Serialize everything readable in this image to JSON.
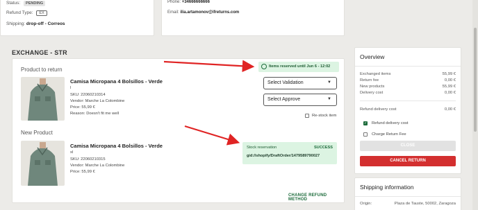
{
  "top_left": {
    "status_label": "Status:",
    "status_value": "PENDING",
    "refund_type_label": "Refund Type:",
    "refund_type_value": "EX",
    "shipping_label": "Shipping:",
    "shipping_value": "drop-off - Correos"
  },
  "top_right": {
    "phone_label": "Phone:",
    "phone_value": "+34666666666",
    "email_label": "Email:",
    "email_value": "ilia.artamonov@ifreturns.com"
  },
  "exchange": {
    "title": "EXCHANGE - STR",
    "product_to_return_label": "Product to return",
    "reserved_badge": "Items reserved until Jun 6 - 12:02",
    "return_item": {
      "name": "Camisa Micropana 4 Bolsillos - Verde",
      "size": "l",
      "sku": "SKU: 22060210314",
      "vendor_label": "Vendor:",
      "vendor": "Marche La Colombine",
      "price": "Price: 55,99 €",
      "reason_label": "Reason:",
      "reason": "Doesn't fit me well"
    },
    "select_validation": "Select Validation",
    "select_approve": "Select Approve",
    "restock_label": "Re-stock item",
    "new_product_label": "New Product",
    "new_item": {
      "name": "Camisa Micropana 4 Bolsillos - Verde",
      "size": "xl",
      "sku": "SKU: 22060210315",
      "vendor_label": "Vendor:",
      "vendor": "Marche La Colombine",
      "price": "Price: 55,99 €"
    },
    "stock": {
      "label": "Stock reservation",
      "status": "SUCCESS",
      "gid": "gid://shopify/DraftOrder/1479589790027"
    },
    "change_refund_method": "CHANGE REFUND METHOD"
  },
  "overview": {
    "title": "Overview",
    "rows": [
      {
        "label": "Exchanged items",
        "value": "55,99 €"
      },
      {
        "label": "Return fee",
        "value": "0,00 €"
      },
      {
        "label": "New products",
        "value": "55,99 €"
      },
      {
        "label": "Delivery cost",
        "value": "0,00 €"
      }
    ],
    "refund_delivery_label": "Refund delivery cost",
    "refund_delivery_value": "0,00 €",
    "refund_delivery_checkbox": "Refund delivery cost",
    "charge_return_fee": "Charge Return Fee",
    "close_button": "CLOSE",
    "cancel_button": "CANCEL RETURN"
  },
  "shipping_info": {
    "title": "Shipping information",
    "origin_label": "Origin:",
    "origin_value": "Plaza de Tauste, 50002, Zaragoza"
  },
  "colors": {
    "accent_green": "#1c6b3b",
    "success_bg": "#dcf4e2",
    "danger": "#d32f2f",
    "arrow": "#e02424"
  }
}
